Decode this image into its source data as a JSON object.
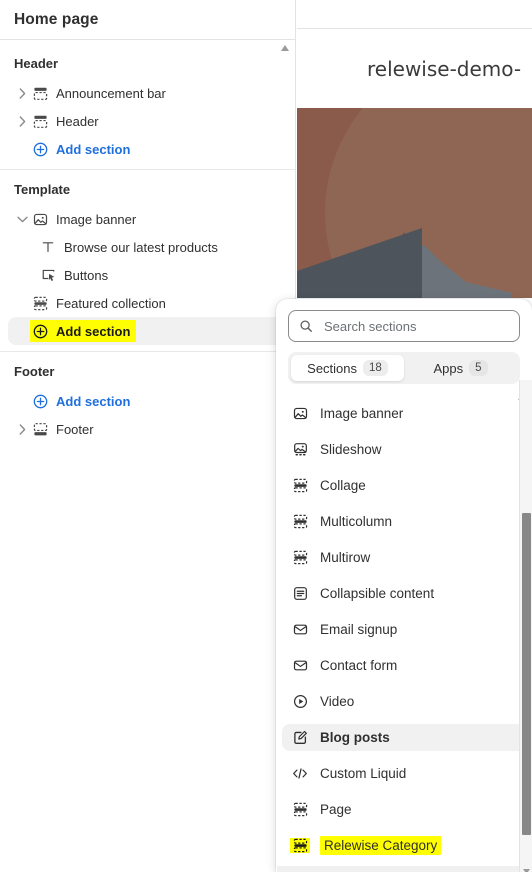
{
  "sidebar": {
    "page_title": "Home page",
    "groups": [
      {
        "title": "Header",
        "rows": [
          {
            "label": "Announcement bar",
            "icon": "section-icon",
            "caret": "chevron-right-icon",
            "type": "section"
          },
          {
            "label": "Header",
            "icon": "section-icon",
            "caret": "chevron-right-icon",
            "type": "section"
          },
          {
            "label": "Add section",
            "icon": "plus-circle-icon",
            "type": "add"
          }
        ]
      },
      {
        "title": "Template",
        "rows": [
          {
            "label": "Image banner",
            "icon": "image-icon",
            "caret": "chevron-down-icon",
            "type": "section"
          },
          {
            "label": "Browse our latest products",
            "icon": "text-icon",
            "type": "block"
          },
          {
            "label": "Buttons",
            "icon": "button-icon",
            "type": "block"
          },
          {
            "label": "Featured collection",
            "icon": "section-icon",
            "type": "section"
          },
          {
            "label": "Add section",
            "icon": "plus-circle-icon",
            "type": "add-selected",
            "highlighted": true
          }
        ]
      },
      {
        "title": "Footer",
        "rows": [
          {
            "label": "Add section",
            "icon": "plus-circle-icon",
            "type": "add"
          },
          {
            "label": "Footer",
            "icon": "section-icon",
            "caret": "chevron-right-icon",
            "type": "section"
          }
        ]
      }
    ]
  },
  "preview": {
    "store_name": "relewise-demo-"
  },
  "popover": {
    "search": {
      "placeholder": "Search sections",
      "value": "",
      "icon": "search-icon"
    },
    "tabs": [
      {
        "label": "Sections",
        "count": "18",
        "active": true
      },
      {
        "label": "Apps",
        "count": "5",
        "active": false
      }
    ],
    "items": [
      {
        "label": "Image banner",
        "icon": "image-icon"
      },
      {
        "label": "Slideshow",
        "icon": "slideshow-icon"
      },
      {
        "label": "Collage",
        "icon": "section-icon"
      },
      {
        "label": "Multicolumn",
        "icon": "section-icon"
      },
      {
        "label": "Multirow",
        "icon": "section-icon"
      },
      {
        "label": "Collapsible content",
        "icon": "collapsible-icon"
      },
      {
        "label": "Email signup",
        "icon": "envelope-icon"
      },
      {
        "label": "Contact form",
        "icon": "envelope-icon"
      },
      {
        "label": "Video",
        "icon": "play-circle-icon"
      },
      {
        "label": "Blog posts",
        "icon": "blog-icon",
        "state": "hover"
      },
      {
        "label": "Custom Liquid",
        "icon": "code-icon"
      },
      {
        "label": "Page",
        "icon": "section-icon"
      },
      {
        "label": "Relewise Category",
        "icon": "section-icon",
        "state": "highlighted"
      }
    ]
  },
  "colors": {
    "accent_link": "#1f6fde",
    "highlight": "#ffff00",
    "hero_brown": "#8a5a4a",
    "hero_brown_light": "#8f6653",
    "hero_gray_dark": "#4d545c",
    "hero_gray_light": "#6d737a"
  }
}
